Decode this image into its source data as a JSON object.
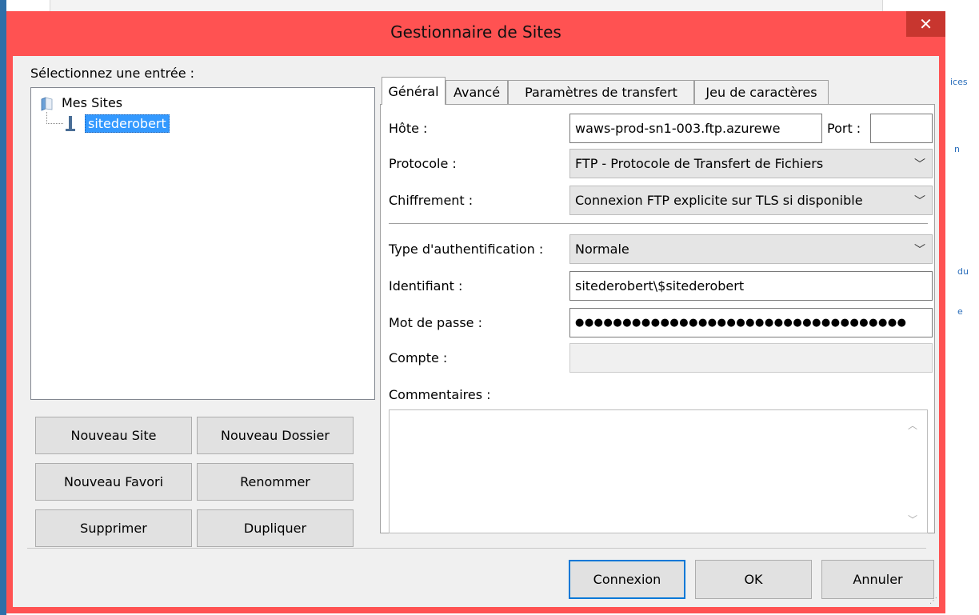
{
  "background": {
    "links": [
      "ices",
      "n",
      "du",
      "e"
    ]
  },
  "dialog": {
    "title": "Gestionnaire de Sites",
    "close_glyph": "✕",
    "select_entry_label": "Sélectionnez une entrée :",
    "tree": {
      "root_label": "Mes Sites",
      "selected_site": "sitederobert"
    },
    "left_buttons": {
      "new_site": "Nouveau Site",
      "new_folder": "Nouveau Dossier",
      "new_bookmark": "Nouveau Favori",
      "rename": "Renommer",
      "delete": "Supprimer",
      "duplicate": "Dupliquer"
    },
    "tabs": [
      "Général",
      "Avancé",
      "Paramètres de transfert",
      "Jeu de caractères"
    ],
    "general": {
      "host_label": "Hôte :",
      "host_value": "waws-prod-sn1-003.ftp.azurewe",
      "port_label": "Port :",
      "port_value": "",
      "protocol_label": "Protocole :",
      "protocol_value": "FTP - Protocole de Transfert de Fichiers",
      "encryption_label": "Chiffrement :",
      "encryption_value": "Connexion FTP explicite sur TLS si disponible",
      "auth_type_label": "Type d'authentification :",
      "auth_type_value": "Normale",
      "user_label": "Identifiant :",
      "user_value": "sitederobert\\$sitederobert",
      "password_label": "Mot de passe :",
      "password_value": "●●●●●●●●●●●●●●●●●●●●●●●●●●●●●●●●●●●",
      "account_label": "Compte :",
      "account_value": "",
      "comments_label": "Commentaires :"
    },
    "footer_buttons": {
      "connect": "Connexion",
      "ok": "OK",
      "cancel": "Annuler"
    },
    "icons": {
      "folder": "folder-icon",
      "server": "server-icon",
      "close": "close-icon",
      "chevron": "chevron-down-icon"
    }
  }
}
